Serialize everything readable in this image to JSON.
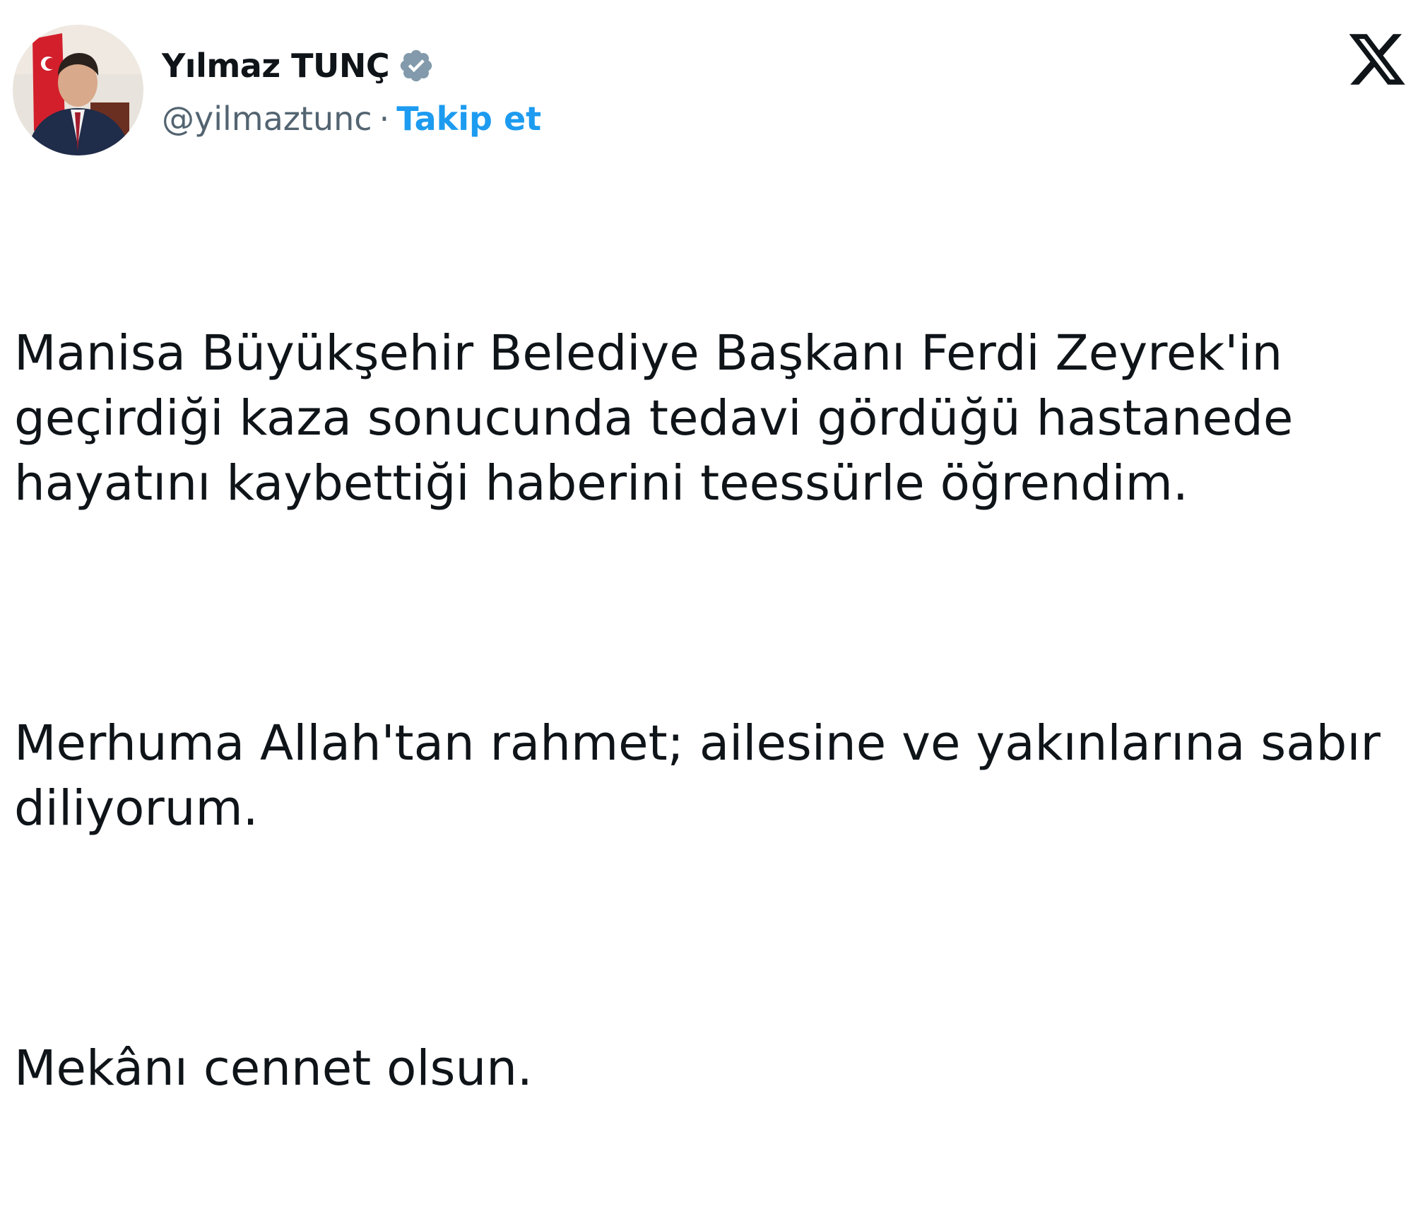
{
  "author": {
    "display_name": "Yılmaz TUNÇ",
    "handle": "@yilmaztunc",
    "separator": "·",
    "follow_label": "Takip et",
    "verified_icon": "verified-badge",
    "avatar": "avatar"
  },
  "platform_logo": "x-logo-icon",
  "tweet": {
    "paragraphs": [
      "Manisa Büyükşehir Belediye Başkanı Ferdi Zeyrek'in geçirdiği kaza sonucunda tedavi gördüğü hastanede hayatını kaybettiği haberini teessürle öğrendim.",
      "Merhuma Allah'tan rahmet; ailesine ve yakınlarına sabır diliyorum.",
      "Mekânı cennet olsun."
    ]
  },
  "colors": {
    "text": "#0f1419",
    "secondary": "#536471",
    "link": "#1d9bf0",
    "verified_badge": "#829aab"
  }
}
